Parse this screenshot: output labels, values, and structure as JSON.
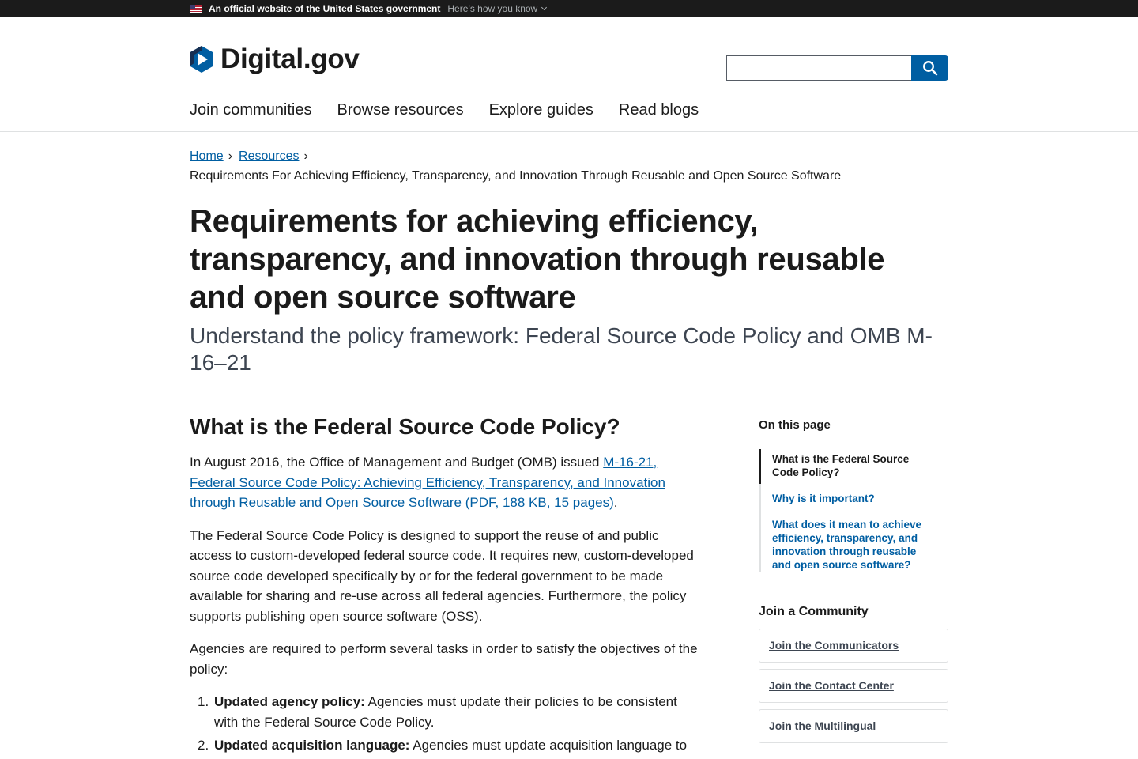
{
  "gov_banner": {
    "text": "An official website of the United States government",
    "link": "Here’s how you know"
  },
  "header": {
    "logo_text": "Digital.gov",
    "search": {
      "placeholder": "",
      "value": ""
    },
    "nav": [
      "Join communities",
      "Browse resources",
      "Explore guides",
      "Read blogs"
    ]
  },
  "breadcrumb": {
    "items": [
      "Home",
      "Resources"
    ],
    "current": "Requirements For Achieving Efficiency, Transparency, and Innovation Through Reusable and Open Source Software"
  },
  "page": {
    "title": "Requirements for achieving efficiency, transparency, and innovation through reusable and open source software",
    "subtitle": "Understand the policy framework: Federal Source Code Policy and OMB M-16–21"
  },
  "content": {
    "h2": "What is the Federal Source Code Policy?",
    "p1_before": "In August 2016, the Office of Management and Budget (OMB) issued ",
    "p1_link": "M-16-21, Federal Source Code Policy: Achieving Efficiency, Transparency, and Innovation through Reusable and Open Source Software (PDF, 188 KB, 15 pages)",
    "p1_after": ".",
    "p2": "The Federal Source Code Policy is designed to support the reuse of and public access to custom-developed federal source code. It requires new, custom-developed source code developed specifically by or for the federal government to be made available for sharing and re-use across all federal agencies. Furthermore, the policy supports publishing open source software (OSS).",
    "p3": "Agencies are required to perform several tasks in order to satisfy the objectives of the policy:",
    "list": [
      {
        "num": "1.",
        "bold": "Updated agency policy:",
        "text": " Agencies must update their policies to be consistent with the Federal Source Code Policy."
      },
      {
        "num": "2.",
        "bold": "Updated acquisition language:",
        "text": " Agencies must update acquisition language to"
      }
    ]
  },
  "sidebar": {
    "on_this_page": "On this page",
    "toc": [
      "What is the Federal Source Code Policy?",
      "Why is it important?",
      "What does it mean to achieve efficiency, transparency, and innovation through reusable and open source software?"
    ],
    "community_heading": "Join a Community",
    "communities": [
      "Join the Communicators",
      "Join the Contact Center",
      "Join the Multilingual"
    ]
  },
  "colors": {
    "link": "#005ea2",
    "banner": "#1b1b1b",
    "search_button": "#005ea2"
  },
  "icons": {
    "search": "search-icon",
    "logo": "digitalgov-logo-icon",
    "flag": "us-flag-icon"
  }
}
